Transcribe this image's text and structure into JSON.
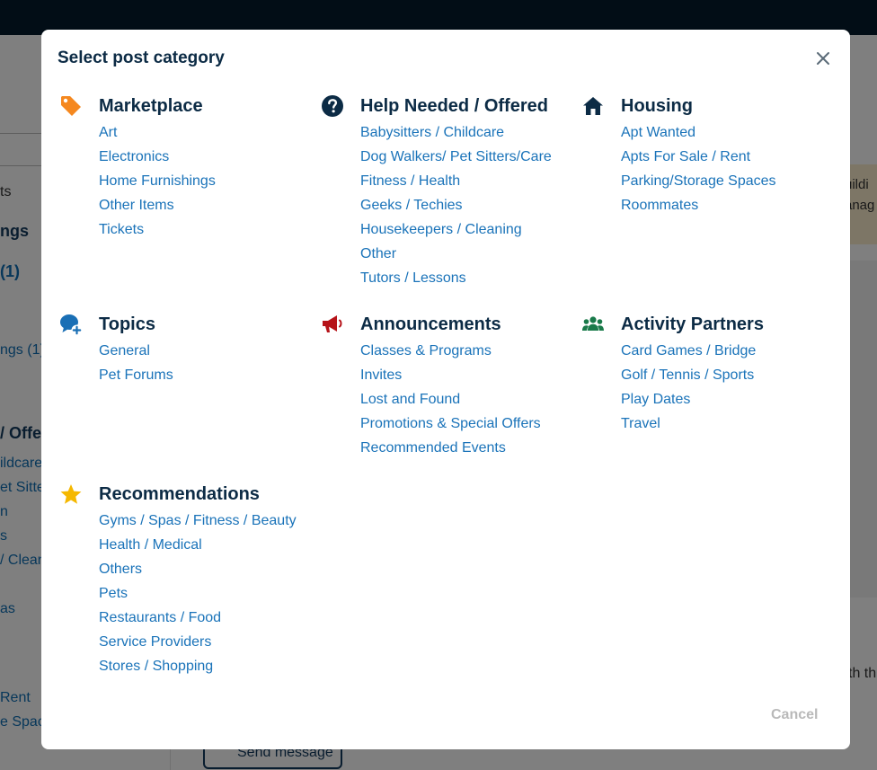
{
  "background": {
    "left_fragments": [
      "ts",
      "ngs",
      "(1)",
      "ngs (1)",
      "/ Offe",
      "ildcare",
      "et Sitte",
      "n",
      "s",
      "/ Clean",
      "as",
      "Rent",
      "e Spac"
    ],
    "right_fragments": [
      "uildi",
      "anag",
      "th th"
    ],
    "send_message_label": "Send message"
  },
  "modal": {
    "title": "Select post category",
    "cancel_label": "Cancel",
    "categories": [
      {
        "title": "Marketplace",
        "icon": "price-tag-icon",
        "color": "#f5881f",
        "links": [
          "Art",
          "Electronics",
          "Home Furnishings",
          "Other Items",
          "Tickets"
        ]
      },
      {
        "title": "Help Needed / Offered",
        "icon": "question-circle-icon",
        "color": "#0c2b45",
        "links": [
          "Babysitters / Childcare",
          "Dog Walkers/ Pet Sitters/Care",
          "Fitness / Health",
          "Geeks / Techies",
          "Housekeepers / Cleaning",
          "Other",
          "Tutors / Lessons"
        ]
      },
      {
        "title": "Housing",
        "icon": "house-icon",
        "color": "#0c2b45",
        "links": [
          "Apt Wanted",
          "Apts For Sale / Rent",
          "Parking/Storage Spaces",
          "Roommates"
        ]
      },
      {
        "title": "Topics",
        "icon": "chat-plus-icon",
        "color": "#1a6fb5",
        "links": [
          "General",
          "Pet Forums"
        ]
      },
      {
        "title": "Announcements",
        "icon": "megaphone-icon",
        "color": "#b61319",
        "links": [
          "Classes & Programs",
          "Invites",
          "Lost and Found",
          "Promotions & Special Offers",
          "Recommended Events"
        ]
      },
      {
        "title": "Activity Partners",
        "icon": "people-group-icon",
        "color": "#1a7a4a",
        "links": [
          "Card Games / Bridge",
          "Golf / Tennis / Sports",
          "Play Dates",
          "Travel"
        ]
      },
      {
        "title": "Recommendations",
        "icon": "star-icon",
        "color": "#f5b800",
        "links": [
          "Gyms / Spas / Fitness / Beauty",
          "Health / Medical",
          "Others",
          "Pets",
          "Restaurants / Food",
          "Service Providers",
          "Stores / Shopping"
        ]
      }
    ]
  }
}
